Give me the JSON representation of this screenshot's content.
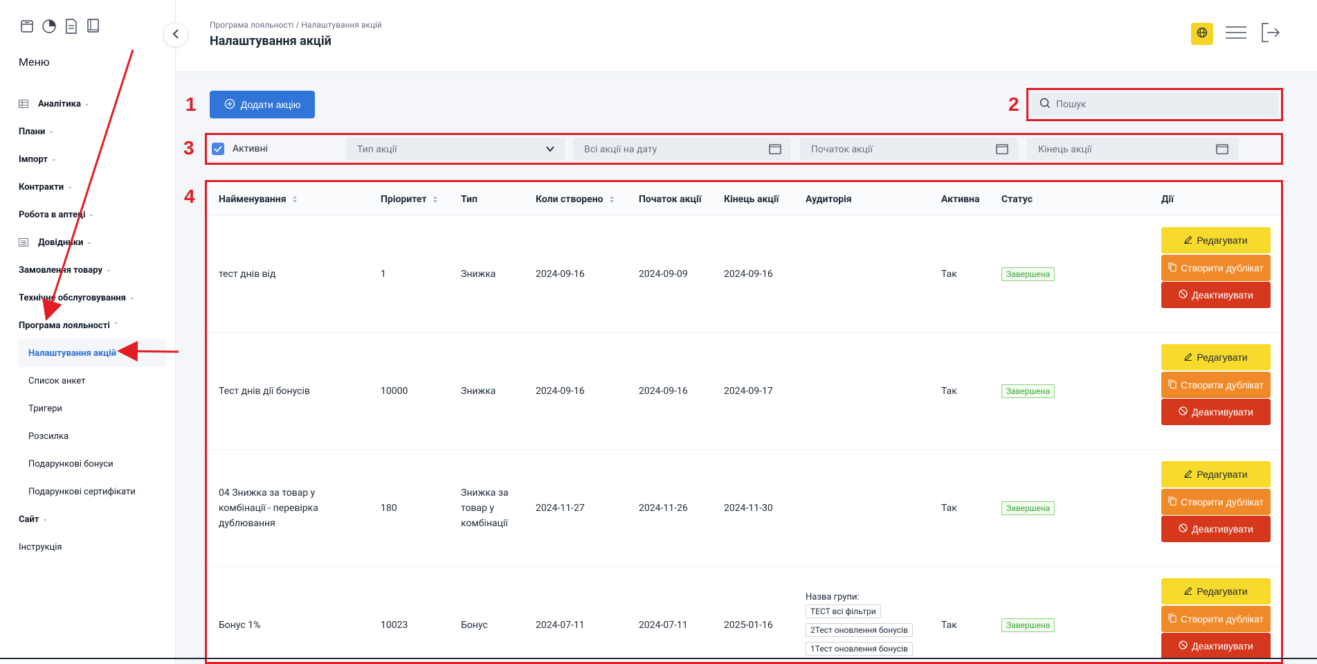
{
  "sidebar": {
    "menu_title": "Меню",
    "items": [
      {
        "label": "Аналітика",
        "icon": "table-icon",
        "chevron": "⌄"
      },
      {
        "label": "Плани",
        "chevron": "⌄"
      },
      {
        "label": "Імпорт",
        "chevron": "⌄"
      },
      {
        "label": "Контракти",
        "chevron": "⌄"
      },
      {
        "label": "Робота в аптеці",
        "chevron": "⌄"
      },
      {
        "label": "Довідники",
        "icon": "list-icon",
        "chevron": "⌄"
      },
      {
        "label": "Замовлення товару",
        "chevron": "⌄"
      },
      {
        "label": "Технічне обслуговування",
        "chevron": "⌄"
      },
      {
        "label": "Програма лояльності",
        "chevron": "⌃"
      }
    ],
    "subitems": [
      {
        "label": "Налаштування акцій",
        "active": true
      },
      {
        "label": "Список анкет"
      },
      {
        "label": "Тригери"
      },
      {
        "label": "Розсилка"
      },
      {
        "label": "Подарункові бонуси"
      },
      {
        "label": "Подарункові сертифікати"
      }
    ],
    "after": [
      {
        "label": "Сайт",
        "chevron": "⌄"
      },
      {
        "label": "Інструкція"
      }
    ]
  },
  "header": {
    "breadcrumb": "Програма лояльності / Налаштування акцій",
    "title": "Налаштування акцій",
    "lang_color": "#f5d327"
  },
  "toolbar": {
    "add_label": "Додати акцію",
    "search_placeholder": "Пошук"
  },
  "filters": {
    "active_label": "Активні",
    "type_placeholder": "Тип акції",
    "date_placeholder": "Всі акції на дату",
    "start_placeholder": "Початок акції",
    "end_placeholder": "Кінець акції"
  },
  "table": {
    "headers": {
      "name": "Найменування",
      "priority": "Пріоритет",
      "type": "Тип",
      "created": "Коли створено",
      "start": "Початок акції",
      "end": "Кінець акції",
      "audience": "Аудиторія",
      "active": "Активна",
      "status": "Статус",
      "actions": "Дії"
    },
    "rows": [
      {
        "name": "тест днів від",
        "priority": "1",
        "type": "Знижка",
        "created": "2024-09-16",
        "start": "2024-09-09",
        "end": "2024-09-16",
        "active": "Так",
        "status": "Завершена"
      },
      {
        "name": "Тест днів дії бонусів",
        "priority": "10000",
        "type": "Знижка",
        "created": "2024-09-16",
        "start": "2024-09-16",
        "end": "2024-09-17",
        "active": "Так",
        "status": "Завершена"
      },
      {
        "name_lines": [
          "04 Знижка за товар у",
          "комбінації - перевірка",
          "дублювання"
        ],
        "priority": "180",
        "type_lines": [
          "Знижка за",
          "товар у",
          "комбінації"
        ],
        "created": "2024-11-27",
        "start": "2024-11-26",
        "end": "2024-11-30",
        "active": "Так",
        "status": "Завершена"
      },
      {
        "name": "Бонус 1%",
        "priority": "10023",
        "type": "Бонус",
        "created": "2024-07-11",
        "start": "2024-07-11",
        "end": "2025-01-16",
        "active": "Так",
        "status": "Завершена",
        "audience_label": "Назва групи:",
        "audience_tags": [
          "ТЕСТ всі фільтри",
          "2Тест оновлення бонусів",
          "1Тест оновлення бонусів"
        ]
      }
    ],
    "actions": {
      "edit": "Редагувати",
      "duplicate": "Створити дублікат",
      "deactivate": "Деактивувати"
    }
  },
  "annotations": [
    "1",
    "2",
    "3",
    "4"
  ],
  "colors": {
    "primary": "#3275d9",
    "highlight": "#e11d25",
    "edit": "#f7da2c",
    "duplicate": "#f08a29",
    "deactivate": "#d5381c",
    "status_green": "#3fa83b"
  }
}
